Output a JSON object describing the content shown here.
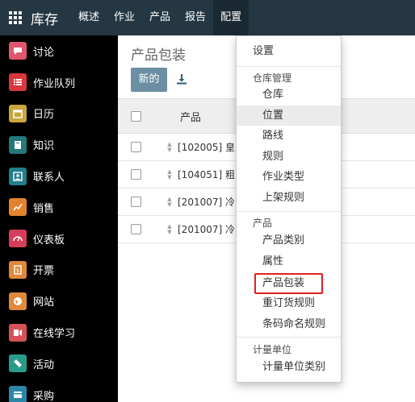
{
  "navbar": {
    "brand": "库存",
    "menus": [
      "概述",
      "作业",
      "产品",
      "报告",
      "配置"
    ]
  },
  "sidebar": {
    "items": [
      {
        "label": "讨论",
        "icon": "chat-icon",
        "color": "#e0566e"
      },
      {
        "label": "作业队列",
        "icon": "list-icon",
        "color": "#d9373e"
      },
      {
        "label": "日历",
        "icon": "calendar-icon",
        "color": "#c7a73e"
      },
      {
        "label": "知识",
        "icon": "book-icon",
        "color": "#23787c"
      },
      {
        "label": "联系人",
        "icon": "contact-card-icon",
        "color": "#217f8a"
      },
      {
        "label": "销售",
        "icon": "chart-icon",
        "color": "#e2822d"
      },
      {
        "label": "仪表板",
        "icon": "gauge-icon",
        "color": "#d63d5a"
      },
      {
        "label": "开票",
        "icon": "invoice-icon",
        "color": "#e0893a"
      },
      {
        "label": "网站",
        "icon": "globe-icon",
        "color": "#df8a3a"
      },
      {
        "label": "在线学习",
        "icon": "elearning-icon",
        "color": "#d6505a"
      },
      {
        "label": "活动",
        "icon": "ticket-icon",
        "color": "#2a9b8a"
      },
      {
        "label": "采购",
        "icon": "credit-card-icon",
        "color": "#2c86a8"
      }
    ]
  },
  "main": {
    "title": "产品包装",
    "new_button": "新的",
    "column_header": "产品",
    "rows": [
      "[102005] 皇",
      "[104051] 粗",
      "[201007] 冷",
      "[201007] 冷"
    ]
  },
  "dropdown": {
    "settings": "设置",
    "sections": [
      {
        "header": "仓库管理",
        "items": [
          "仓库",
          "位置",
          "路线",
          "规则",
          "作业类型",
          "上架规则"
        ]
      },
      {
        "header": "产品",
        "items": [
          "产品类别",
          "属性",
          "产品包装",
          "重订货规则",
          "条码命名规则"
        ]
      },
      {
        "header": "计量单位",
        "items": [
          "计量单位类别"
        ]
      }
    ]
  },
  "colors": {
    "navbar": "#243742",
    "sidebar": "#000000",
    "new_button": "#6b8fa3",
    "highlight": "#e02020"
  }
}
